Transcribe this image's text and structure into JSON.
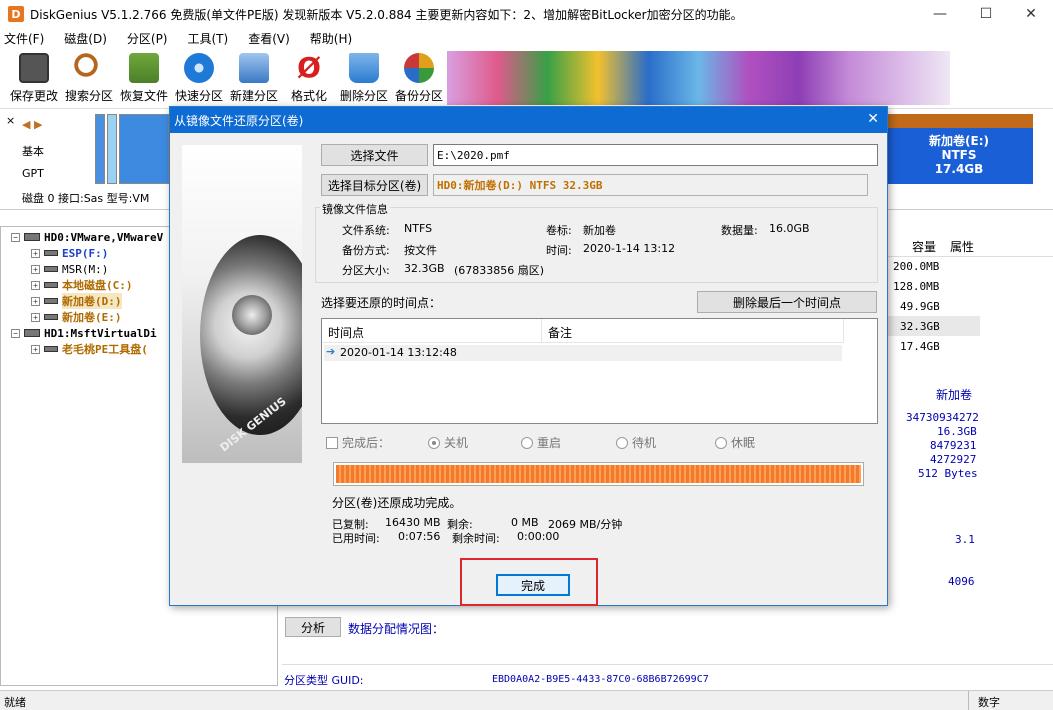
{
  "window": {
    "app_icon": "D",
    "title": "DiskGenius V5.1.2.766 免费版(单文件PE版)  发现新版本 V5.2.0.884 主要更新内容如下：2、增加解密BitLocker加密分区的功能。",
    "min": "—",
    "max": "☐",
    "close": "✕"
  },
  "menu": [
    "文件(F)",
    "磁盘(D)",
    "分区(P)",
    "工具(T)",
    "查看(V)",
    "帮助(H)"
  ],
  "toolbar": [
    {
      "label": "保存更改",
      "icon": "save-icon",
      "color": "#555555"
    },
    {
      "label": "搜索分区",
      "icon": "search-icon",
      "color": "#b5651d"
    },
    {
      "label": "恢复文件",
      "icon": "recover-icon",
      "color": "#4d7f2a"
    },
    {
      "label": "快速分区",
      "icon": "quick-partition-icon",
      "color": "#1e7ad6"
    },
    {
      "label": "新建分区",
      "icon": "new-partition-icon",
      "color": "#3b78c4"
    },
    {
      "label": "格式化",
      "icon": "format-icon",
      "color": "#d81e1e"
    },
    {
      "label": "删除分区",
      "icon": "delete-icon",
      "color": "#2a7bd0"
    },
    {
      "label": "备份分区",
      "icon": "backup-icon",
      "color": "#e0a01a"
    }
  ],
  "disk_panel": {
    "type": "基本",
    "style": "GPT",
    "info": "磁盘 0 接口:Sas  型号:VM",
    "partition_e": {
      "name": "新加卷(E:)",
      "fs": "NTFS",
      "size": "17.4GB"
    }
  },
  "tree": [
    {
      "text": "HD0:VMware,VMwareV",
      "level": 0,
      "color": "#000000"
    },
    {
      "text": "ESP(F:)",
      "level": 1,
      "color": "#1a3fd0"
    },
    {
      "text": "MSR(M:)",
      "level": 1,
      "color": "#000000"
    },
    {
      "text": "本地磁盘(C:)",
      "level": 1,
      "color": "#b06a00"
    },
    {
      "text": "新加卷(D:)",
      "level": 1,
      "color": "#b06a00"
    },
    {
      "text": "新加卷(E:)",
      "level": 1,
      "color": "#b06a00"
    },
    {
      "text": "HD1:MsftVirtualDi",
      "level": 0,
      "color": "#000000"
    },
    {
      "text": "老毛桃PE工具盘(",
      "level": 1,
      "color": "#b06a00"
    }
  ],
  "right_panel": {
    "col_capacity": "容量",
    "col_attr": "属性",
    "capacities": [
      "200.0MB",
      "128.0MB",
      "49.9GB",
      "32.3GB",
      "17.4GB"
    ],
    "vol_name": "新加卷",
    "details": [
      "34730934272",
      "16.3GB",
      "8479231",
      "4272927",
      "512 Bytes"
    ],
    "version": "3.1",
    "cluster": "4096",
    "analyze_btn": "分析",
    "alloc_label": "数据分配情况图：",
    "guid_label": "分区类型 GUID:",
    "guid_value": "EBD0A0A2-B9E5-4433-87C0-68B6B72699C7"
  },
  "status": {
    "left": "就绪",
    "right": "数字"
  },
  "dialog": {
    "title": "从镜像文件还原分区(卷)",
    "close": "✕",
    "logo_text": "DISK GENIUS",
    "select_file_btn": "选择文件",
    "file_path": "E:\\2020.pmf",
    "select_target_btn": "选择目标分区(卷)",
    "target": "HD0:新加卷(D:) NTFS 32.3GB",
    "info_group": "镜像文件信息",
    "fs_label": "文件系统:",
    "fs_value": "NTFS",
    "vol_label": "卷标:",
    "vol_value": "新加卷",
    "data_label": "数据量:",
    "data_value": "16.0GB",
    "backup_mode_label": "备份方式:",
    "backup_mode_value": "按文件",
    "time_label": "时间:",
    "time_value": "2020-1-14 13:12",
    "size_label": "分区大小:",
    "size_value": "32.3GB",
    "size_sectors": "(67833856 扇区)",
    "select_point_label": "选择要还原的时间点：",
    "delete_last_btn": "删除最后一个时间点",
    "col_time": "时间点",
    "col_note": "备注",
    "row_time": "2020-01-14 13:12:48",
    "after_label": "完成后：",
    "radios": [
      "关机",
      "重启",
      "待机",
      "休眠"
    ],
    "progress": 1.0,
    "result": "分区(卷)还原成功完成。",
    "copied_label": "已复制:",
    "copied_value": "16430 MB",
    "remain_label": "剩余:",
    "remain_value": "0 MB",
    "speed": "2069 MB/分钟",
    "elapsed_label": "已用时间:",
    "elapsed_value": "0:07:56",
    "remain_time_label": "剩余时间:",
    "remain_time_value": "0:00:00",
    "finish_btn": "完成"
  }
}
